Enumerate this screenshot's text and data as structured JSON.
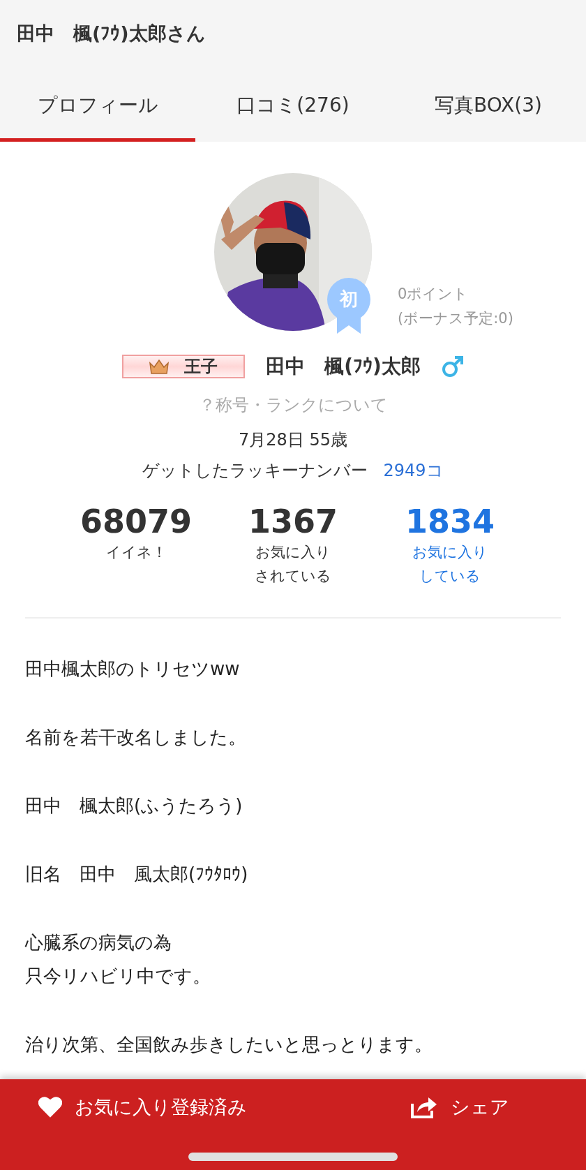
{
  "header": {
    "title": "田中　楓(ﾌｳ)太郎さん"
  },
  "tabs": [
    {
      "label": "プロフィール",
      "selected": true
    },
    {
      "label": "口コミ(276)",
      "selected": false
    },
    {
      "label": "写真BOX(3)",
      "selected": false
    }
  ],
  "profile": {
    "badge": "初",
    "points": "0ポイント",
    "bonus": "(ボーナス予定:0)",
    "rank": "王子",
    "name": "田中　楓(ﾌｳ)太郎",
    "rank_link": "？称号・ランクについて",
    "birthday_age": "7月28日 55歳",
    "lucky_label": "ゲットしたラッキーナンバー",
    "lucky_count": "2949コ"
  },
  "stats": [
    {
      "value": "68079",
      "label": [
        "イイネ！"
      ],
      "link": false
    },
    {
      "value": "1367",
      "label": [
        "お気に入り",
        "されている"
      ],
      "link": false
    },
    {
      "value": "1834",
      "label": [
        "お気に入り",
        "している"
      ],
      "link": true
    }
  ],
  "bio": [
    [
      "田中楓太郎のトリセツww"
    ],
    [
      "名前を若干改名しました。"
    ],
    [
      "田中　楓太郎(ふうたろう)"
    ],
    [
      "旧名　田中　風太郎(ﾌｳﾀﾛｳ)"
    ],
    [
      "心臓系の病気の為",
      "只今リハビリ中です。"
    ],
    [
      "治り次第、全国飲み歩きしたいと思っとります。"
    ]
  ],
  "footer": {
    "favorite": {
      "label": "お気に入り登録済み",
      "checked": true
    },
    "share": {
      "label": "シェア"
    }
  }
}
